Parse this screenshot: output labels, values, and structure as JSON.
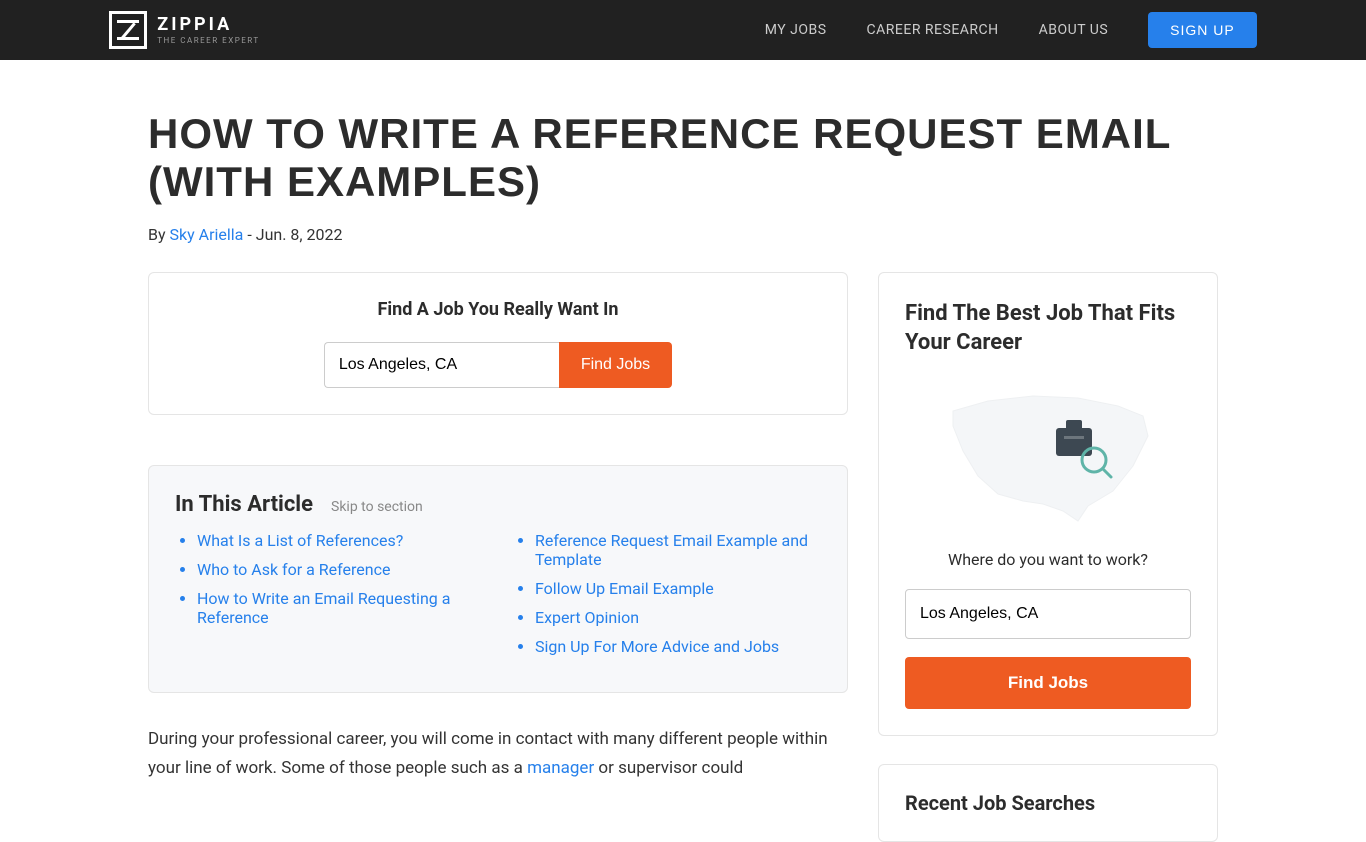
{
  "brand": {
    "name": "ZIPPIA",
    "tagline": "THE CAREER EXPERT"
  },
  "nav": {
    "my_jobs": "MY JOBS",
    "career_research": "CAREER RESEARCH",
    "about_us": "ABOUT US",
    "signup": "SIGN UP"
  },
  "article": {
    "title": "HOW TO WRITE A REFERENCE REQUEST EMAIL (WITH EXAMPLES)",
    "by_prefix": "By ",
    "author": "Sky Ariella",
    "date_sep": " - ",
    "date": "Jun. 8, 2022",
    "intro_1": "During your professional career, you will come in contact with many different people within your line of work. Some of those people such as a ",
    "intro_link": "manager",
    "intro_2": " or supervisor could"
  },
  "find": {
    "title": "Find A Job You Really Want In",
    "location": "Los Angeles, CA",
    "button": "Find Jobs"
  },
  "toc": {
    "title": "In This Article",
    "skip": "Skip to section",
    "left": [
      "What Is a List of References?",
      "Who to Ask for a Reference",
      "How to Write an Email Requesting a Reference"
    ],
    "right": [
      "Reference Request Email Example and Template",
      "Follow Up Email Example",
      "Expert Opinion",
      "Sign Up For More Advice and Jobs"
    ]
  },
  "sidebar": {
    "best_title": "Find The Best Job That Fits Your Career",
    "question": "Where do you want to work?",
    "location": "Los Angeles, CA",
    "button": "Find Jobs",
    "recent_title": "Recent Job Searches"
  }
}
